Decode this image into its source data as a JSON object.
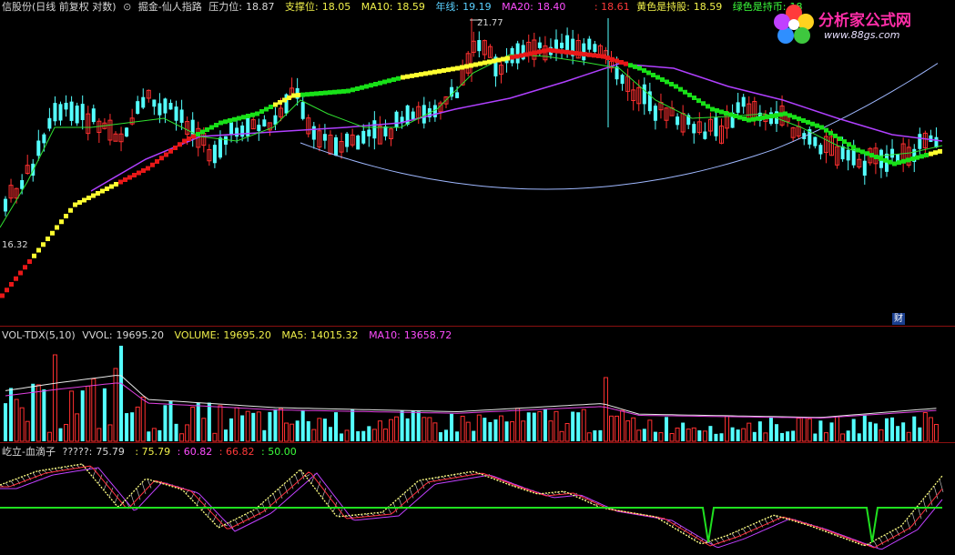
{
  "main": {
    "title": "信股份(日线 前复权 对数)",
    "indicator_name": "掘金-仙人指路",
    "pressure_label": "压力位:",
    "pressure_value": "18.87",
    "support_label": "支撑位:",
    "support_value": "18.05",
    "ma10_label": "MA10:",
    "ma10_value": "18.59",
    "year_label": "年线:",
    "year_value": "19.19",
    "ma20_label": "MA20:",
    "ma20_value": "18.40",
    "hidden_value": ": 18.61",
    "yellow_label": "黄色是持股:",
    "yellow_value": "18.59",
    "green_label": "绿色是持币:",
    "green_value": "18",
    "high_label": "21.77",
    "low_label": "16.32",
    "badge": "财"
  },
  "volume": {
    "title": "VOL-TDX(5,10)",
    "vvol_label": "VVOL:",
    "vvol_value": "19695.20",
    "volume_label": "VOLUME:",
    "volume_value": "19695.20",
    "ma5_label": "MA5:",
    "ma5_value": "14015.32",
    "ma10_label": "MA10:",
    "ma10_value": "13658.72"
  },
  "osc": {
    "title": "屹立-血滴子",
    "v1_label": "?????:",
    "v1_value": "75.79",
    "v2_value": ": 75.79",
    "v3_value": ": 60.82",
    "v4_value": ": 66.82",
    "v5_value": ": 50.00"
  },
  "logo": {
    "brand": "分析家公式网",
    "url": "www.88gs.com"
  },
  "colors": {
    "up": "#ff3030",
    "down": "#54ffff",
    "yellow": "#ffff30",
    "green": "#18e018",
    "red": "#e81818",
    "purple": "#c020ff",
    "yearline": "#9fb8ff",
    "bg": "#000000"
  }
}
